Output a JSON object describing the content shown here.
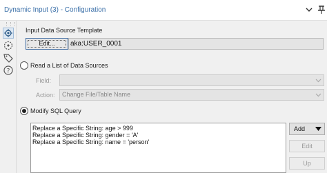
{
  "window": {
    "title": "Dynamic Input (3) - Configuration"
  },
  "sidebar": {
    "icons": [
      "gear-icon",
      "annotation-icon",
      "tag-icon",
      "help-icon"
    ]
  },
  "template": {
    "label": "Input Data Source Template",
    "edit_button": "Edit...",
    "connection_value": "aka:USER_0001"
  },
  "read_list": {
    "label": "Read a List of Data Sources",
    "selected": false,
    "field_label": "Field:",
    "field_value": "",
    "action_label": "Action:",
    "action_value": "Change File/Table Name"
  },
  "modify_sql": {
    "label": "Modify SQL Query",
    "selected": true,
    "items": [
      "Replace a Specific String: age > 999",
      "Replace a Specific String: gender = 'A'",
      "Replace a Specific String: name = 'person'"
    ],
    "add_button": "Add",
    "edit_button": "Edit",
    "up_button": "Up"
  }
}
